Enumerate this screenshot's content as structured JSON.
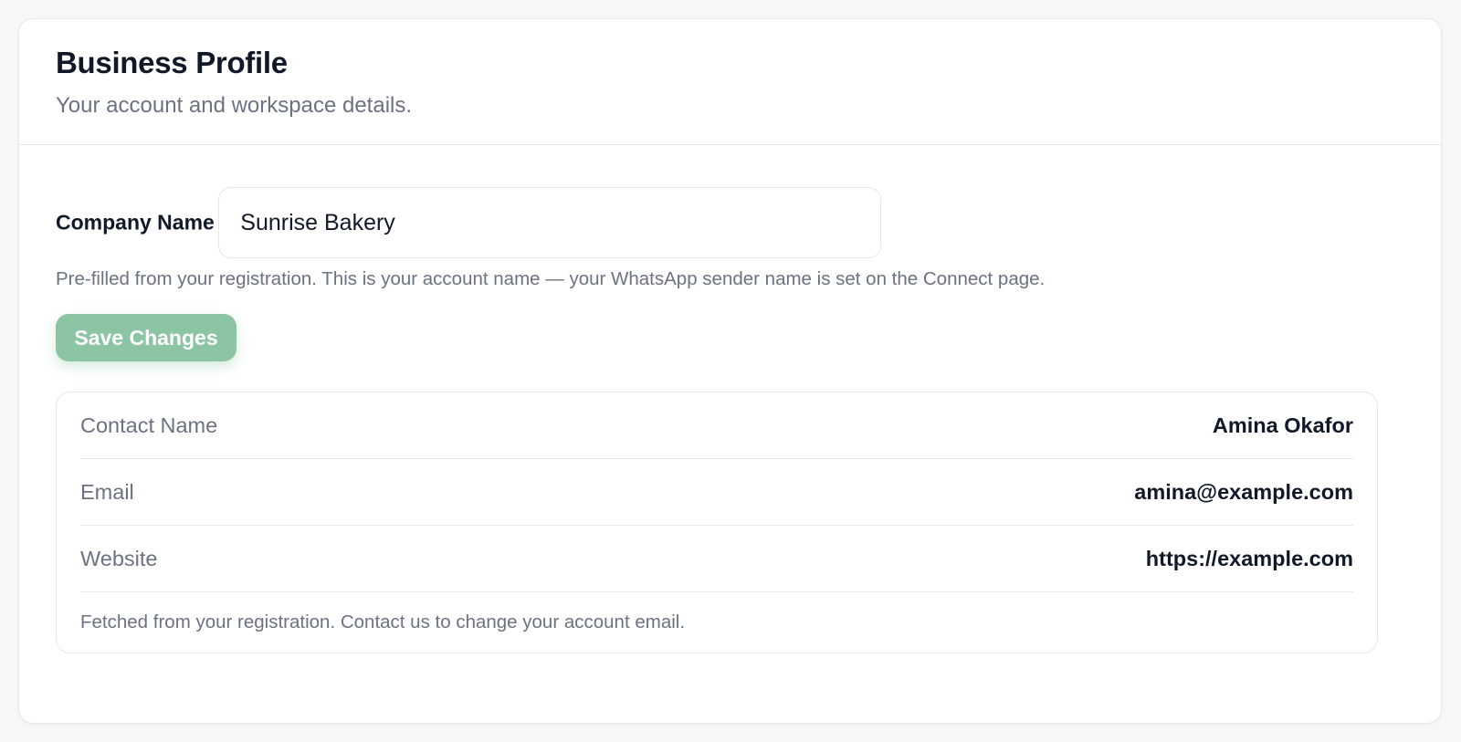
{
  "header": {
    "title": "Business Profile",
    "subtitle": "Your account and workspace details."
  },
  "company_name": {
    "label": "Company Name",
    "value": "Sunrise Bakery",
    "hint": "Pre-filled from your registration. This is your account name — your WhatsApp sender name is set on the Connect page."
  },
  "actions": {
    "save_label": "Save Changes"
  },
  "account_info": {
    "rows": [
      {
        "label": "Contact Name",
        "value": "Amina Okafor"
      },
      {
        "label": "Email",
        "value": "amina@example.com"
      },
      {
        "label": "Website",
        "value": "https://example.com"
      }
    ],
    "note": "Fetched from your registration. Contact us to change your account email."
  },
  "colors": {
    "accent": "#8cc5a3",
    "background": "#f6f8f7",
    "text_primary": "#111827",
    "text_muted": "#6b7280",
    "border": "#e5e7eb"
  }
}
